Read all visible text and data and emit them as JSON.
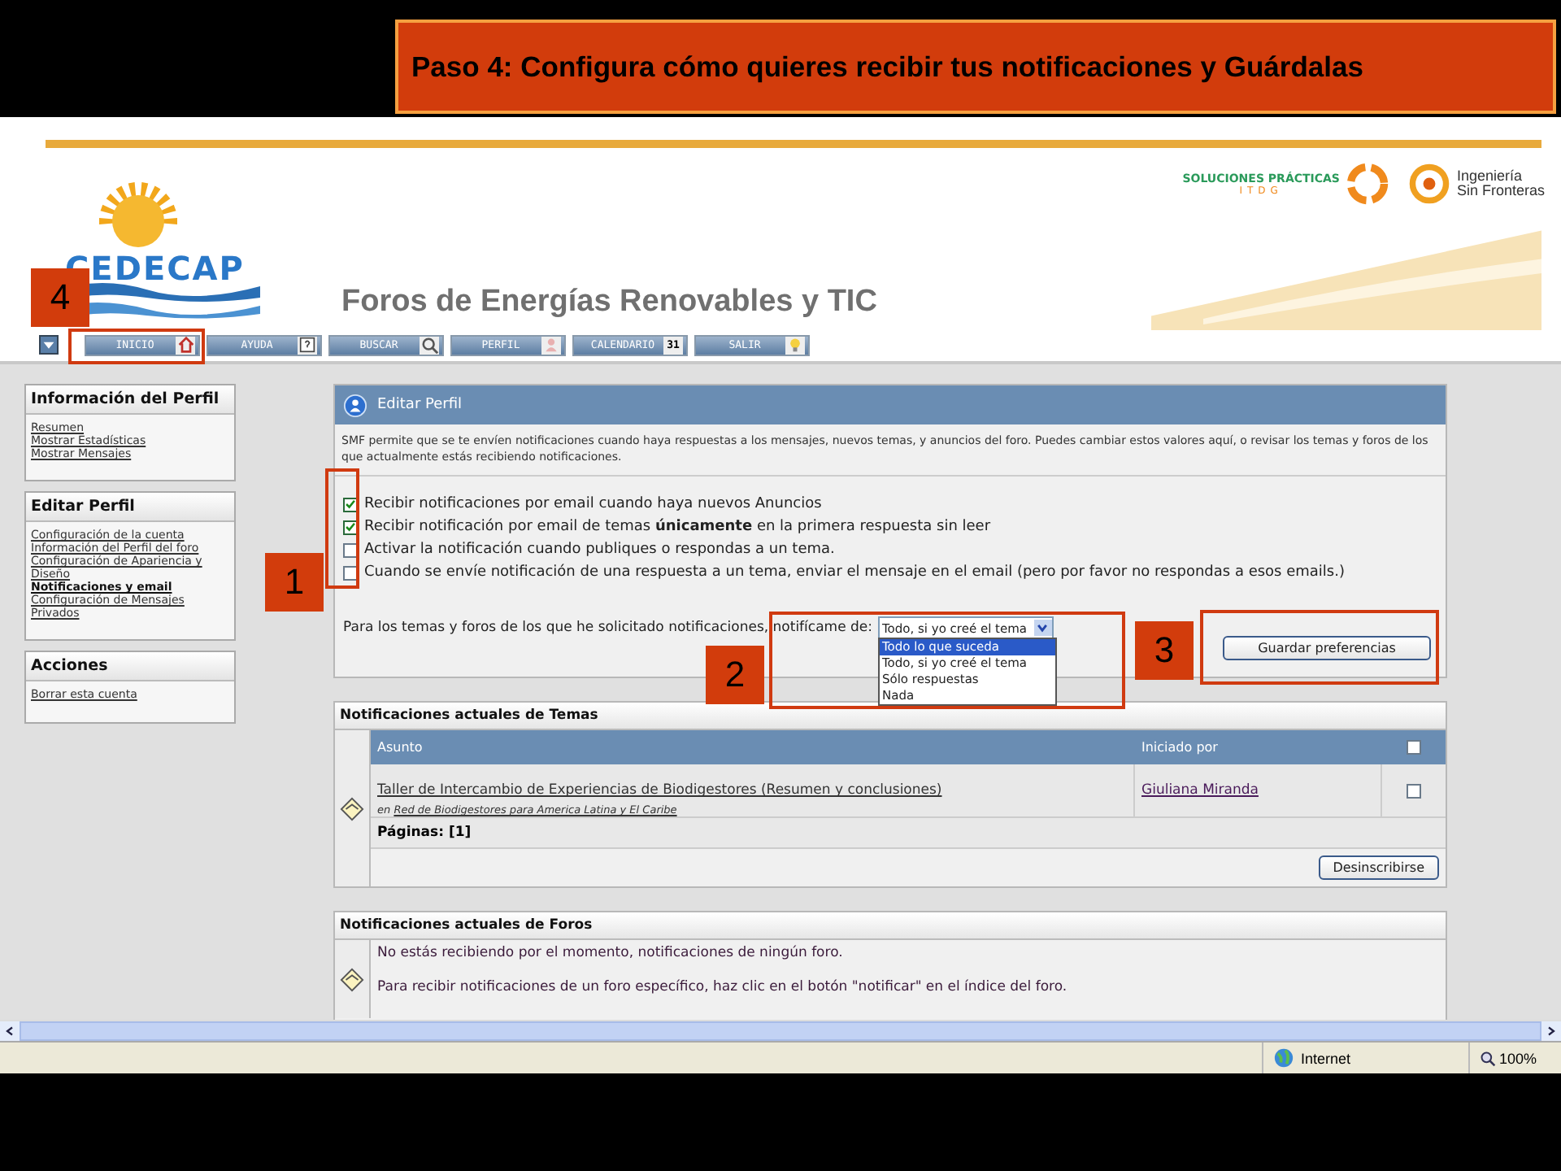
{
  "slide_title": "Paso 4: Configura cómo quieres recibir tus notificaciones y Guárdalas",
  "header": {
    "logo": "CEDECAP",
    "site_title": "Foros de Energías Renovables y TIC",
    "partners": [
      {
        "kind": "soluciones",
        "line1": "SOLUCIONES PRÁCTICAS",
        "line2": "ITDG"
      },
      {
        "kind": "isf",
        "line1": "Ingeniería",
        "line2": "Sin Fronteras"
      }
    ]
  },
  "nav": [
    {
      "label": "INICIO",
      "kind": "home"
    },
    {
      "label": "AYUDA",
      "kind": "help"
    },
    {
      "label": "BUSCAR",
      "kind": "search"
    },
    {
      "label": "PERFIL",
      "kind": "profile"
    },
    {
      "label": "CALENDARIO",
      "kind": "calendar",
      "badge": "31"
    },
    {
      "label": "SALIR",
      "kind": "exit"
    }
  ],
  "sidebar": [
    {
      "title": "Información del Perfil",
      "links": [
        {
          "label": "Resumen",
          "selected": false
        },
        {
          "label": "Mostrar Estadísticas",
          "selected": false
        },
        {
          "label": "Mostrar Mensajes",
          "selected": false
        }
      ]
    },
    {
      "title": "Editar Perfil",
      "links": [
        {
          "label": "Configuración de la cuenta",
          "selected": false
        },
        {
          "label": "Información del Perfil del foro",
          "selected": false
        },
        {
          "label": "Configuración de Apariencia y Diseño",
          "selected": false
        },
        {
          "label": "Notificaciones y email",
          "selected": true
        },
        {
          "label": "Configuración de Mensajes Privados",
          "selected": false
        }
      ]
    },
    {
      "title": "Acciones",
      "links": [
        {
          "label": "Borrar esta cuenta",
          "selected": false
        }
      ]
    }
  ],
  "edit_panel": {
    "title": "Editar Perfil",
    "description": "SMF permite que se te envíen notificaciones cuando haya respuestas a los mensajes, nuevos temas, y anuncios del foro. Puedes cambiar estos valores aquí, o revisar los temas y foros de los que actualmente estás recibiendo notificaciones.",
    "options": [
      {
        "label": "Recibir notificaciones por email cuando haya nuevos Anuncios",
        "checked": true
      },
      {
        "label": "Recibir notificación por email de temas **únicamente** en la primera respuesta sin leer",
        "checked": true
      },
      {
        "label": "Activar la notificación cuando publiques o respondas a un tema.",
        "checked": false
      },
      {
        "label": "Cuando se envíe notificación de una respuesta a un tema, enviar el mensaje en el email (pero por favor no respondas a esos emails.)",
        "checked": false
      }
    ],
    "notify_label": "Para los temas y foros de los que he solicitado notificaciones, notifícame de:",
    "notify_select": {
      "value": "Todo, si yo creé el tema",
      "expanded": true,
      "options": [
        {
          "label": "Todo lo que suceda",
          "highlighted": true
        },
        {
          "label": "Todo, si yo creé el tema",
          "highlighted": false
        },
        {
          "label": "Sólo respuestas",
          "highlighted": false
        },
        {
          "label": "Nada",
          "highlighted": false
        }
      ]
    },
    "save_button": "Guardar preferencias"
  },
  "topics": {
    "title": "Notificaciones actuales de Temas",
    "columns": [
      "Asunto",
      "Iniciado por"
    ],
    "header_checked": false,
    "rows": [
      {
        "subject": "Taller de Intercambio de Experiencias de Biodigestores (Resumen y conclusiones)",
        "board_prefix": "en",
        "board": "Red de Biodigestores para America Latina y El Caribe",
        "started_by": "Giuliana Miranda",
        "checked": false
      }
    ],
    "pages": "Páginas: [1]",
    "button": "Desinscribirse"
  },
  "forums": {
    "title": "Notificaciones actuales de Foros",
    "messages": [
      "No estás recibiendo por el momento, notificaciones de ningún foro.",
      "Para recibir notificaciones de un foro específico, haz clic en el botón \"notificar\" en el índice del foro."
    ]
  },
  "status_bar": {
    "zone": "Internet",
    "zoom": "100%"
  },
  "callouts": [
    {
      "number": "1"
    },
    {
      "number": "2"
    },
    {
      "number": "3"
    },
    {
      "number": "4"
    }
  ]
}
